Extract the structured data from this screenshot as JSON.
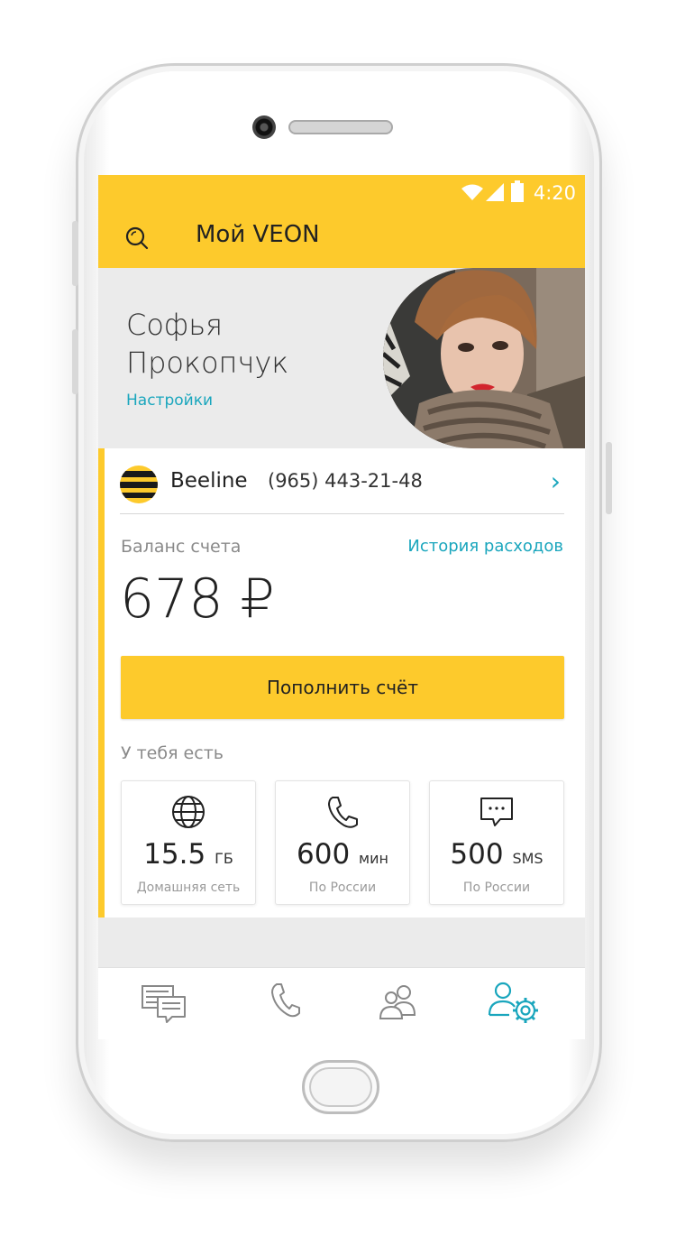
{
  "status_bar": {
    "time": "4:20"
  },
  "app_bar": {
    "title": "Мой VEON",
    "search_icon": "search-icon"
  },
  "profile": {
    "first_name": "Софья",
    "last_name": "Прокопчук",
    "settings_link": "Настройки"
  },
  "account": {
    "operator": "Beeline",
    "phone": "(965) 443-21-48",
    "balance_label": "Баланс счета",
    "history_link": "История расходов",
    "balance": "678 ₽",
    "topup_button": "Пополнить счёт",
    "have_label": "У тебя есть"
  },
  "tiles": [
    {
      "icon": "globe-icon",
      "value": "15.5",
      "unit": "ГБ",
      "caption": "Домашняя сеть"
    },
    {
      "icon": "phone-icon",
      "value": "600",
      "unit": "мин",
      "caption": "По России"
    },
    {
      "icon": "message-icon",
      "value": "500",
      "unit": "SMS",
      "caption": "По России"
    }
  ],
  "bottom_nav": [
    {
      "icon": "chats-icon",
      "active": false
    },
    {
      "icon": "phone-icon",
      "active": false
    },
    {
      "icon": "contacts-icon",
      "active": false
    },
    {
      "icon": "profile-settings-icon",
      "active": true
    }
  ],
  "colors": {
    "brand_yellow": "#fdca2c",
    "accent_teal": "#1aa6bd"
  }
}
